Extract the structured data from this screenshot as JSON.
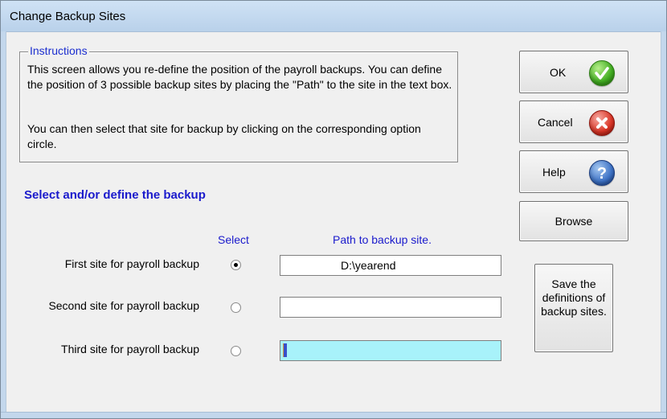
{
  "window": {
    "title": "Change Backup Sites"
  },
  "instructions": {
    "legend": "Instructions",
    "paragraph1": "This screen allows you re-define the position of the payroll backups.  You can define the position of 3 possible backup sites by placing the \"Path\" to the site in the text box.",
    "paragraph2": "You can then select that site for backup by clicking on the corresponding option circle."
  },
  "section": {
    "heading": "Select and/or define the backup"
  },
  "columns": {
    "select": "Select",
    "path": "Path to backup site."
  },
  "sites": [
    {
      "label": "First site for payroll backup",
      "path": "D:\\yearend",
      "selected": true
    },
    {
      "label": "Second site for payroll backup",
      "path": "",
      "selected": false
    },
    {
      "label": "Third site for payroll backup",
      "path": "",
      "selected": false,
      "focused": true
    }
  ],
  "buttons": {
    "ok": "OK",
    "cancel": "Cancel",
    "help": "Help",
    "browse": "Browse",
    "save": "Save the definitions of backup sites."
  },
  "icons": {
    "ok": "check-icon",
    "cancel": "x-icon",
    "help": "question-icon"
  },
  "colors": {
    "accent_text": "#1a1acc",
    "focused_field": "#a8f2fa"
  }
}
